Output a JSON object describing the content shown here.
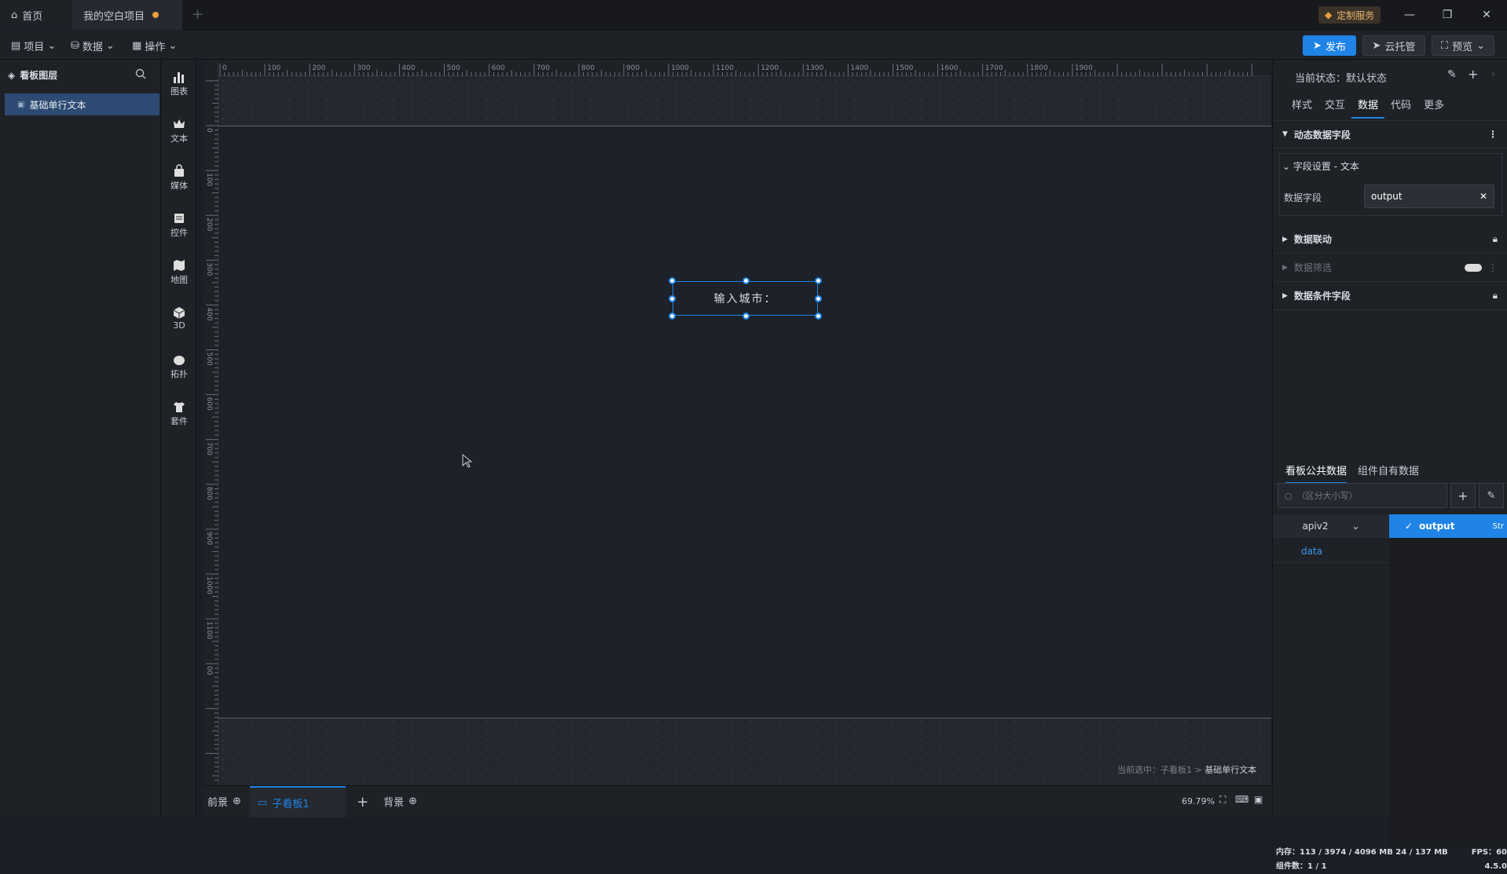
{
  "titlebar": {
    "tabs": [
      {
        "label": "首页"
      },
      {
        "label": "我的空白项目"
      }
    ],
    "vip_label": "定制服务"
  },
  "toolbar": {
    "menus": [
      {
        "label": "项目"
      },
      {
        "label": "数据"
      },
      {
        "label": "操作"
      }
    ],
    "publish_label": "发布",
    "cloud_label": "云托管",
    "preview_label": "预览"
  },
  "layers": {
    "title": "看板图层",
    "items": [
      {
        "label": "基础单行文本"
      }
    ]
  },
  "components": [
    {
      "label": "图表",
      "icon": "bar-chart-icon"
    },
    {
      "label": "文本",
      "icon": "text-crown-icon"
    },
    {
      "label": "媒体",
      "icon": "media-bag-icon"
    },
    {
      "label": "控件",
      "icon": "control-icon"
    },
    {
      "label": "地图",
      "icon": "map-icon"
    },
    {
      "label": "3D",
      "icon": "cube-icon"
    },
    {
      "label": "拓扑",
      "icon": "topology-icon"
    },
    {
      "label": "套件",
      "icon": "kit-shirt-icon"
    }
  ],
  "ruler": {
    "h_ticks": [
      "0",
      "100",
      "200",
      "300",
      "400",
      "500",
      "600",
      "700",
      "800",
      "900",
      "1000",
      "1100",
      "1200",
      "1300",
      "1400",
      "1500",
      "1600",
      "1700",
      "1800",
      "1900"
    ],
    "v_ticks": [
      "0",
      "100",
      "200",
      "300",
      "400",
      "500",
      "600",
      "700",
      "800",
      "900",
      "1000",
      "1100",
      "00"
    ]
  },
  "canvas": {
    "selected_text": "输入城市：",
    "crumb_prefix": "当前选中：子看板1 >",
    "crumb_current": "基础单行文本"
  },
  "bottombar": {
    "foreground": "前景",
    "active_tab": "子看板1",
    "background": "背景",
    "zoom": "69.79%"
  },
  "rpanel": {
    "state_label": "当前状态：默认状态",
    "tabs": [
      {
        "label": "样式"
      },
      {
        "label": "交互"
      },
      {
        "label": "数据"
      },
      {
        "label": "代码"
      },
      {
        "label": "更多"
      }
    ],
    "sections": {
      "dynamic": "动态数据字段",
      "field_setting": "字段设置 - 文本",
      "field_label": "数据字段",
      "field_value": "output",
      "linkage": "数据联动",
      "filter": "数据筛选",
      "condition": "数据条件字段"
    },
    "subtabs": [
      {
        "label": "看板公共数据"
      },
      {
        "label": "组件自有数据"
      }
    ],
    "search_placeholder": "（区分大小写）",
    "api_name": "apiv2",
    "output_name": "output",
    "output_type": "Str",
    "data_item": "data",
    "memory": "内存：113 / 3974 / 4096 MB  24 / 137 MB",
    "fps": "FPS：60",
    "count": "组件数：1 / 1",
    "version": "4.5.0"
  },
  "colors": {
    "accent": "#1f84e6",
    "canvas_bg": "#1c212a",
    "panel_bg": "#1e2126"
  }
}
